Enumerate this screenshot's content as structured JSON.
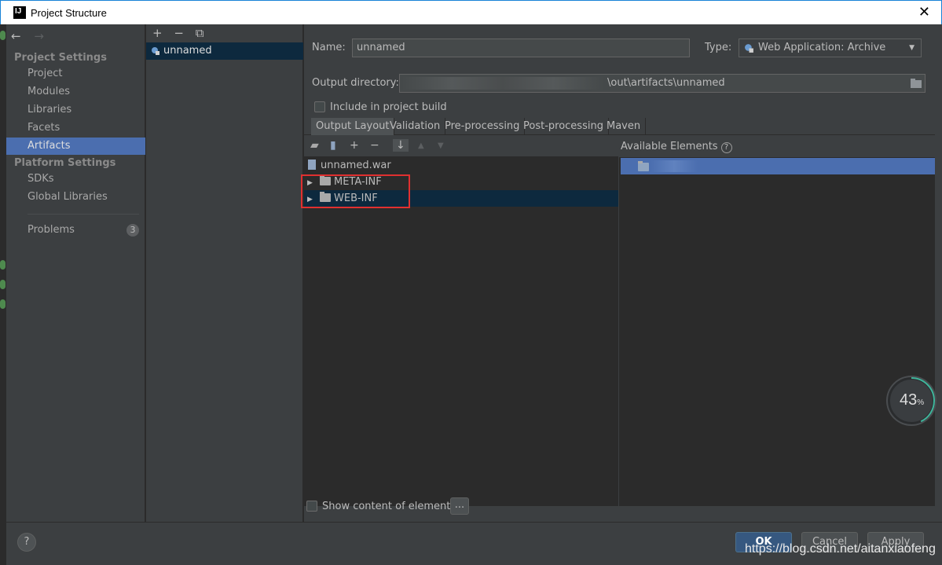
{
  "window": {
    "title": "Project Structure",
    "close_glyph": "✕"
  },
  "nav": {
    "back": "←",
    "forward": "→"
  },
  "sidebar": {
    "project_settings_heading": "Project Settings",
    "platform_settings_heading": "Platform Settings",
    "items": [
      {
        "label": "Project"
      },
      {
        "label": "Modules"
      },
      {
        "label": "Libraries"
      },
      {
        "label": "Facets"
      },
      {
        "label": "Artifacts",
        "selected": true
      },
      {
        "label": "SDKs"
      },
      {
        "label": "Global Libraries"
      },
      {
        "label": "Problems",
        "badge": "3"
      }
    ]
  },
  "artifacts": {
    "tools": {
      "add": "+",
      "remove": "−",
      "copy": "⧉"
    },
    "list": [
      {
        "label": "unnamed",
        "icon": "web-archive-icon"
      }
    ]
  },
  "form": {
    "name_label": "Name:",
    "name_value": "unnamed",
    "type_label": "Type:",
    "type_value": "Web Application: Archive",
    "output_dir_label": "Output directory:",
    "output_dir_value": "\\out\\artifacts\\unnamed",
    "include_label": "Include in project build",
    "include_checked": false
  },
  "tabs": [
    {
      "label": "Output Layout",
      "active": true
    },
    {
      "label": "Validation"
    },
    {
      "label": "Pre-processing"
    },
    {
      "label": "Post-processing"
    },
    {
      "label": "Maven"
    }
  ],
  "layout_tree": {
    "tools": {
      "new_dir": "▰",
      "archive": "▮",
      "add": "+",
      "remove": "−",
      "sort": "↓",
      "up": "▲",
      "down": "▼"
    },
    "root": "unnamed.war",
    "children": [
      {
        "label": "META-INF"
      },
      {
        "label": "WEB-INF",
        "selected": true
      }
    ]
  },
  "available": {
    "heading": "Available Elements",
    "help": "?"
  },
  "bottom": {
    "show_content_label": "Show content of elements",
    "more_button": "...",
    "help_button": "?",
    "ok": "OK",
    "cancel": "Cancel",
    "apply": "Apply"
  },
  "overlay": {
    "watermark": "https://blog.csdn.net/aitanxiaofeng",
    "gauge_value": "43",
    "gauge_unit": "%",
    "gauge_fraction": 0.43
  },
  "colors": {
    "accent": "#4b6eaf",
    "selection_dark": "#0d293e",
    "highlight_box": "#e03030",
    "primary_button": "#365880"
  }
}
